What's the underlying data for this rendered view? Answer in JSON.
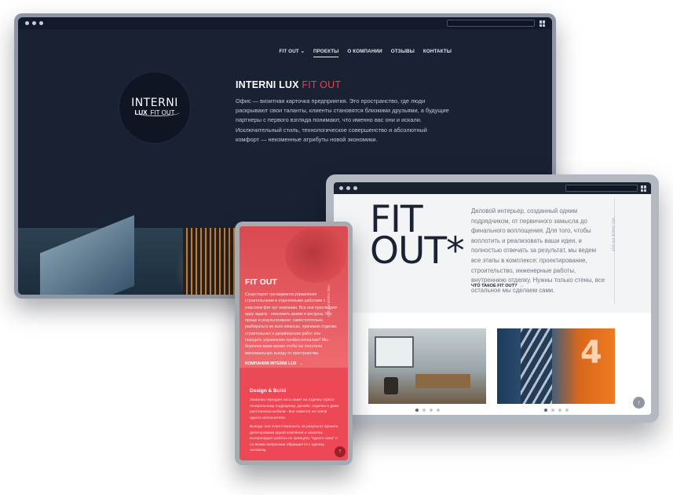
{
  "desktop": {
    "nav": [
      "FIT OUT ⌄",
      "ПРОЕКТЫ",
      "О КОМПАНИИ",
      "ОТЗЫВЫ",
      "КОНТАКТЫ"
    ],
    "logo": {
      "top": "INTERNI",
      "bottom_bold": "LUX",
      "bottom_light": "FIT OUT"
    },
    "title_main": "INTERNI LUX",
    "title_accent": "FIT OUT",
    "text": "Офис — визитная карточка предприятия. Это пространство, где люди раскрывают свои таланты, клиенты становятся близкими друзьями, а будущие партнеры с первого взгляда понимают, что именно вас они и искали. Исключительный стиль, технологическое совершенство и абсолютный комфорт — неизменные атрибуты новой экономики."
  },
  "tablet": {
    "heading_line1": "FIT",
    "heading_line2": "OUT*",
    "text": "Деловой интерьер, созданный одним подрядчиком, от первичного замысла до финального воплощения. Для того, чтобы воплотить и реализовать ваши идеи, и полностью отвечать за результат, мы ведем все этапы в комплексе: проектирование, строительство, инженерные работы, внутреннюю отделку. Нужны только стены, все остальное мы сделаем сами.",
    "link": "ЧТО ТАКОЕ FIT OUT?",
    "vertical_label": "ЧТО ТАКОЕ FIT OUT"
  },
  "phone": {
    "title": "FIT OUT",
    "vertical_label": "ЧТО ТАКОЕ FIT OUT",
    "text": "Существуют три варианта управления строительными и отделочными работами с участием фит аут компании. Все они преследуют одну задачу - экономить время и ресурсы. Что проще и результативнее: самостоятельно разбираться во всех нюансах, принимая отделки, строительных и дизайнерских работ или передать управление профессионалам? Мы бережем ваше время чтобы вы получали максимальную выгоду от пространства.",
    "link": "КОМПАНИЯ INTERNI LUX",
    "card_title": "Design & Build",
    "card_text1": "Заказчик передает весь пакет на отделку офиса генеральному подрядчику. Дизайн, отделка и даже расстановка мебели - все ложится на плечи одного исполнителя.",
    "card_text2": "Выгода: вся ответственность за результат проекта делегирована одной компании и заказчик контролирует работы по принципу \"одного окна\" и со всеми вопросами обращается к одному человеку."
  },
  "icons": {
    "arrow_right": "→",
    "arrow_up": "↑"
  }
}
